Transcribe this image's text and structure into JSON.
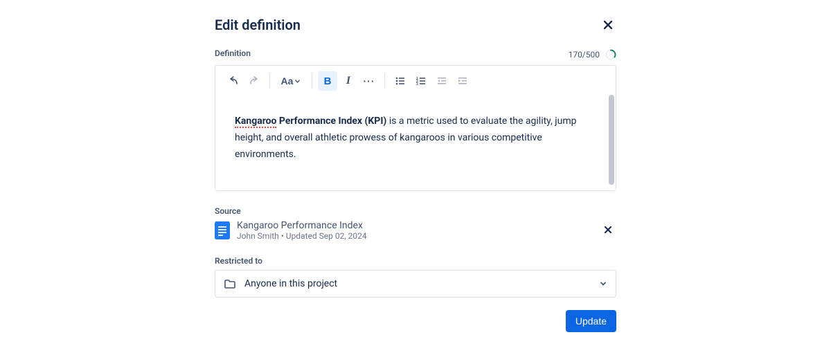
{
  "modal": {
    "title": "Edit definition"
  },
  "definition": {
    "label": "Definition",
    "counter": "170/500",
    "content_bold_spelled": "Kangaroo",
    "content_bold_rest": " Performance Index (KPI)",
    "content_rest": " is a metric used to evaluate the agility, jump height, and overall athletic prowess of kangaroos in various competitive environments."
  },
  "source": {
    "label": "Source",
    "title": "Kangaroo Performance Index",
    "meta": "John Smith  •  Updated Sep 02, 2024"
  },
  "restricted": {
    "label": "Restricted to",
    "value": "Anyone in this project"
  },
  "buttons": {
    "update": "Update"
  },
  "toolbar": {
    "text_style": "Aa"
  },
  "colors": {
    "primary": "#0C66E4",
    "progress_ring": "#1F845A"
  }
}
